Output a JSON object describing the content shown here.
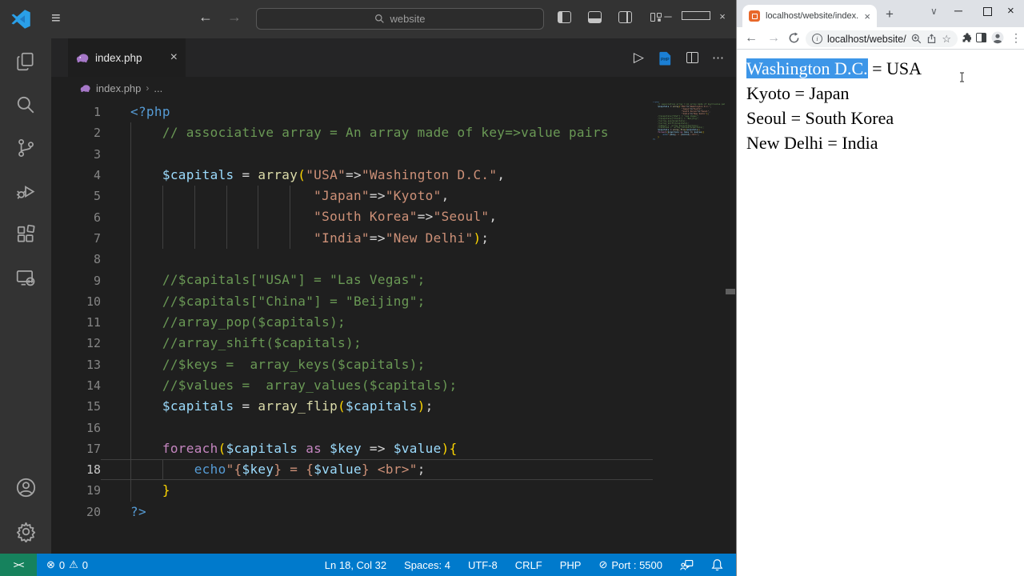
{
  "vscode": {
    "titlebar": {
      "search_value": "website"
    },
    "tab": {
      "label": "index.php",
      "close": "×"
    },
    "breadcrumb": {
      "file": "index.php",
      "separator": "›",
      "more": "..."
    },
    "editor_actions": {
      "run": "▷",
      "more": "⋯"
    },
    "editor_lines": [
      {
        "n": "1",
        "tokens": [
          [
            "kwb",
            "<?php"
          ]
        ]
      },
      {
        "n": "2",
        "tokens": [
          [
            "ws",
            "    "
          ],
          [
            "com",
            "// associative array = An array made of key=>value pairs"
          ]
        ]
      },
      {
        "n": "3",
        "tokens": []
      },
      {
        "n": "4",
        "tokens": [
          [
            "ws",
            "    "
          ],
          [
            "var",
            "$capitals"
          ],
          [
            "op",
            " = "
          ],
          [
            "fn",
            "array"
          ],
          [
            "brk",
            "("
          ],
          [
            "str",
            "\"USA\""
          ],
          [
            "op",
            "=>"
          ],
          [
            "str",
            "\"Washington D.C.\""
          ],
          [
            "pun",
            ","
          ]
        ]
      },
      {
        "n": "5",
        "tokens": [
          [
            "ws",
            "                       "
          ],
          [
            "str",
            "\"Japan\""
          ],
          [
            "op",
            "=>"
          ],
          [
            "str",
            "\"Kyoto\""
          ],
          [
            "pun",
            ","
          ]
        ]
      },
      {
        "n": "6",
        "tokens": [
          [
            "ws",
            "                       "
          ],
          [
            "str",
            "\"South Korea\""
          ],
          [
            "op",
            "=>"
          ],
          [
            "str",
            "\"Seoul\""
          ],
          [
            "pun",
            ","
          ]
        ]
      },
      {
        "n": "7",
        "tokens": [
          [
            "ws",
            "                       "
          ],
          [
            "str",
            "\"India\""
          ],
          [
            "op",
            "=>"
          ],
          [
            "str",
            "\"New Delhi\""
          ],
          [
            "brk",
            ")"
          ],
          [
            "pun",
            ";"
          ]
        ]
      },
      {
        "n": "8",
        "tokens": []
      },
      {
        "n": "9",
        "tokens": [
          [
            "ws",
            "    "
          ],
          [
            "com",
            "//$capitals[\"USA\"] = \"Las Vegas\";"
          ]
        ]
      },
      {
        "n": "10",
        "tokens": [
          [
            "ws",
            "    "
          ],
          [
            "com",
            "//$capitals[\"China\"] = \"Beijing\";"
          ]
        ]
      },
      {
        "n": "11",
        "tokens": [
          [
            "ws",
            "    "
          ],
          [
            "com",
            "//array_pop($capitals);"
          ]
        ]
      },
      {
        "n": "12",
        "tokens": [
          [
            "ws",
            "    "
          ],
          [
            "com",
            "//array_shift($capitals);"
          ]
        ]
      },
      {
        "n": "13",
        "tokens": [
          [
            "ws",
            "    "
          ],
          [
            "com",
            "//$keys =  array_keys($capitals);"
          ]
        ]
      },
      {
        "n": "14",
        "tokens": [
          [
            "ws",
            "    "
          ],
          [
            "com",
            "//$values =  array_values($capitals);"
          ]
        ]
      },
      {
        "n": "15",
        "tokens": [
          [
            "ws",
            "    "
          ],
          [
            "var",
            "$capitals"
          ],
          [
            "op",
            " = "
          ],
          [
            "fn",
            "array_flip"
          ],
          [
            "brk",
            "("
          ],
          [
            "var",
            "$capitals"
          ],
          [
            "brk",
            ")"
          ],
          [
            "pun",
            ";"
          ]
        ]
      },
      {
        "n": "16",
        "tokens": []
      },
      {
        "n": "17",
        "tokens": [
          [
            "ws",
            "    "
          ],
          [
            "kwp",
            "foreach"
          ],
          [
            "brk",
            "("
          ],
          [
            "var",
            "$capitals"
          ],
          [
            "kwp",
            " as "
          ],
          [
            "var",
            "$key"
          ],
          [
            "op",
            " => "
          ],
          [
            "var",
            "$value"
          ],
          [
            "brk",
            "){"
          ]
        ]
      },
      {
        "n": "18",
        "current": true,
        "tokens": [
          [
            "ws",
            "        "
          ],
          [
            "kwb",
            "echo"
          ],
          [
            "str",
            "\"{"
          ],
          [
            "var",
            "$key"
          ],
          [
            "str",
            "} = {"
          ],
          [
            "var",
            "$value"
          ],
          [
            "str",
            "} <br>\""
          ],
          [
            "pun",
            ";"
          ]
        ]
      },
      {
        "n": "19",
        "tokens": [
          [
            "ws",
            "    "
          ],
          [
            "brk",
            "}"
          ]
        ]
      },
      {
        "n": "20",
        "tokens": [
          [
            "kwb",
            "?>"
          ]
        ]
      }
    ],
    "statusbar": {
      "remote": "><",
      "errors": "0",
      "warnings": "0",
      "error_icon": "⊗",
      "warning_icon": "⚠",
      "items": [
        {
          "label": "Ln 18, Col 32"
        },
        {
          "label": "Spaces: 4"
        },
        {
          "label": "UTF-8"
        },
        {
          "label": "CRLF"
        },
        {
          "label": "PHP"
        },
        {
          "icon": "⊘",
          "label": "Port : 5500"
        }
      ]
    },
    "colors": {
      "statusbar": "#007acc",
      "remote_badge": "#16825d",
      "accent": "#569cd6"
    }
  },
  "browser": {
    "tab_title": "localhost/website/index.php",
    "tab_close": "×",
    "new_tab": "+",
    "chevron": "∨",
    "url": "localhost/website/index...",
    "bookmark_star": "☆",
    "kebab": "⋮",
    "page_lines": [
      {
        "selected": "Washington D.C.",
        "rest": " = USA"
      },
      {
        "text": "Kyoto = Japan"
      },
      {
        "text": "Seoul = South Korea"
      },
      {
        "text": "New Delhi = India"
      }
    ],
    "selection_color": "#3d96e8"
  }
}
